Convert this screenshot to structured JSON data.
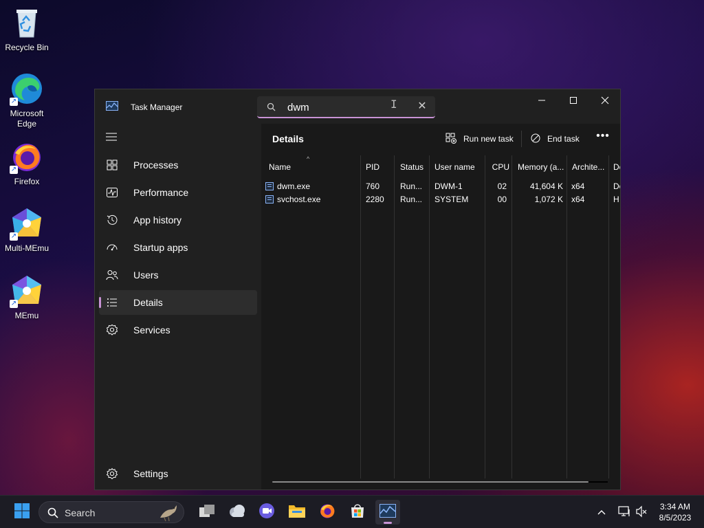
{
  "desktop": {
    "icons": [
      {
        "label": "Recycle Bin",
        "icon": "recycle-bin-icon"
      },
      {
        "label": "Microsoft Edge",
        "icon": "edge-icon"
      },
      {
        "label": "Firefox",
        "icon": "firefox-icon"
      },
      {
        "label": "Multi-MEmu",
        "icon": "multi-memu-icon"
      },
      {
        "label": "MEmu",
        "icon": "memu-icon"
      }
    ]
  },
  "window": {
    "title": "Task Manager",
    "search": {
      "value": "dwm",
      "placeholder": ""
    },
    "controls": {
      "minimize": "—",
      "maximize": "☐",
      "close": "✕"
    }
  },
  "sidebar": {
    "items": [
      {
        "label": "Processes",
        "icon": "processes-icon"
      },
      {
        "label": "Performance",
        "icon": "performance-icon"
      },
      {
        "label": "App history",
        "icon": "app-history-icon"
      },
      {
        "label": "Startup apps",
        "icon": "startup-apps-icon"
      },
      {
        "label": "Users",
        "icon": "users-icon"
      },
      {
        "label": "Details",
        "icon": "details-icon",
        "active": true
      },
      {
        "label": "Services",
        "icon": "services-icon"
      }
    ],
    "settings": {
      "label": "Settings",
      "icon": "settings-icon"
    }
  },
  "details": {
    "title": "Details",
    "run_new_task": "Run new task",
    "end_task": "End task",
    "more": "•••",
    "columns": [
      "Name",
      "PID",
      "Status",
      "User name",
      "CPU",
      "Memory (a...",
      "Archite...",
      "De"
    ],
    "rows": [
      [
        "dwm.exe",
        "760",
        "Run...",
        "DWM-1",
        "02",
        "41,604 K",
        "x64",
        "De"
      ],
      [
        "svchost.exe",
        "2280",
        "Run...",
        "SYSTEM",
        "00",
        "1,072 K",
        "x64",
        "H"
      ]
    ]
  },
  "taskbar": {
    "search_label": "Search",
    "apps": [
      "task-view-icon",
      "weather-icon",
      "teams-icon",
      "file-explorer-icon",
      "firefox-icon",
      "store-icon",
      "task-manager-icon"
    ],
    "active_app": "task-manager-icon",
    "tray": {
      "chevron": "^"
    },
    "time": "3:34 AM",
    "date": "8/5/2023"
  },
  "colors": {
    "accent": "#c993d6",
    "window_bg": "#202020",
    "content_bg": "#191919"
  }
}
